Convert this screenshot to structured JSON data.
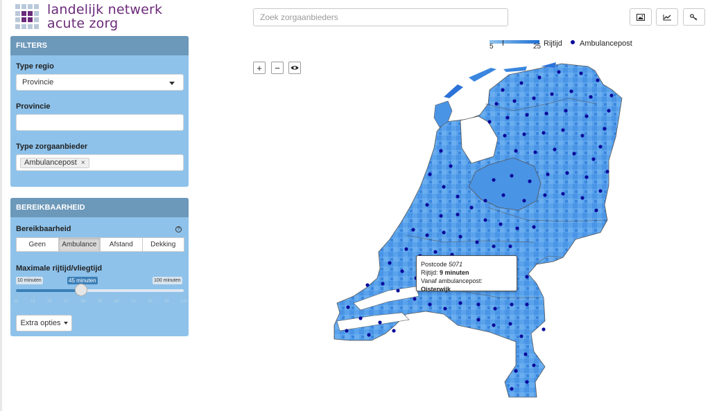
{
  "brand": {
    "line1": "landelijk netwerk",
    "line2": "acute zorg",
    "purple": "#6b2a7a"
  },
  "search": {
    "placeholder": "Zoek zorgaanbieders",
    "value": ""
  },
  "toolbar": {
    "icons": [
      "image-icon",
      "chart-line-icon",
      "key-icon"
    ]
  },
  "filters": {
    "header": "FILTERS",
    "type_regio_label": "Type regio",
    "type_regio_value": "Provincie",
    "provincie_label": "Provincie",
    "provincie_value": "",
    "type_zorg_label": "Type zorgaanbieder",
    "type_zorg_tag": "Ambulancepost",
    "tag_remove": "×"
  },
  "bereikbaarheid": {
    "header": "BEREIKBAARHEID",
    "label": "Bereikbaarheid",
    "help": "?",
    "options": [
      "Geen",
      "Ambulance",
      "Afstand",
      "Dekking"
    ],
    "selected": "Ambulance",
    "max_label": "Maximale rijtijd/vliegtijd",
    "min_text": "10 minuten",
    "current_text": "45 minuten",
    "max_text": "100 minuten",
    "slider_min": 10,
    "slider_max": 100,
    "slider_value": 45,
    "tick_labels": [
      "10",
      "19",
      "28",
      "37",
      "46",
      "55",
      "64",
      "73",
      "82",
      "91",
      "100"
    ],
    "extra_button": "Extra opties"
  },
  "map_controls": {
    "zoom_in": "+",
    "zoom_out": "−"
  },
  "legend": {
    "min": "5",
    "max": "25",
    "scale_label": "Rijtijd",
    "series_label": "Ambulancepost",
    "colors": {
      "low": "#8fc3ee",
      "high": "#1f6fd2",
      "post": "#0a0a9a"
    }
  },
  "tooltip": {
    "postcode_label": "Postcode",
    "postcode_value": "5071",
    "rijtijd_label": "Rijtijd:",
    "rijtijd_value": "9 minuten",
    "post_label": "Vanaf ambulancepost:",
    "post_value": "Oisterwijk"
  }
}
